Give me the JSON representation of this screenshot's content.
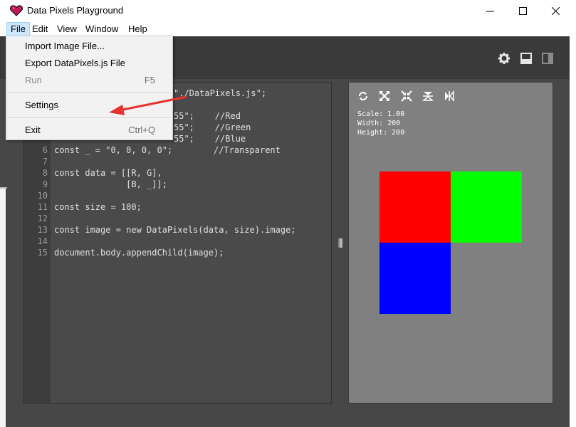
{
  "window": {
    "title": "Data Pixels Playground",
    "min_glyph": "—",
    "max_glyph": "☐",
    "close_glyph": "✕"
  },
  "menubar": {
    "items": [
      "File",
      "Edit",
      "View",
      "Window",
      "Help"
    ]
  },
  "file_menu": {
    "items": [
      {
        "label": "Import Image File...",
        "shortcut": "",
        "enabled": true
      },
      {
        "label": "Export DataPixels.js File",
        "shortcut": "",
        "enabled": true
      },
      {
        "label": "Run",
        "shortcut": "F5",
        "enabled": false
      },
      {
        "label": "Settings",
        "shortcut": "",
        "enabled": true
      },
      {
        "label": "Exit",
        "shortcut": "Ctrl+Q",
        "enabled": true
      }
    ]
  },
  "toolbar": {
    "icons": [
      "gear-icon",
      "layout-horizontal-icon",
      "layout-vertical-icon"
    ]
  },
  "editor": {
    "lines": [
      {
        "n": "",
        "text": "\"./DataPixels.js\";",
        "x": 0
      },
      {
        "n": "",
        "text": "",
        "x": 0
      },
      {
        "n": "",
        "text": "55\";    //Red",
        "x": 0
      },
      {
        "n": "",
        "text": "55\";    //Green",
        "x": 0
      },
      {
        "n": "",
        "text": "55\";    //Blue",
        "x": 0
      },
      {
        "n": "6",
        "text": "const _ = \"0, 0, 0, 0\";        //Transparent",
        "x": 0
      },
      {
        "n": "7",
        "text": "",
        "x": 0
      },
      {
        "n": "8",
        "text": "const data = [[R, G],",
        "x": 0
      },
      {
        "n": "9",
        "text": "              [B, _]];",
        "x": 0
      },
      {
        "n": "10",
        "text": "",
        "x": 0
      },
      {
        "n": "11",
        "text": "const size = 100;",
        "x": 0
      },
      {
        "n": "12",
        "text": "",
        "x": 0
      },
      {
        "n": "13",
        "text": "const image = new DataPixels(data, size).image;",
        "x": 0
      },
      {
        "n": "14",
        "text": "",
        "x": 0
      },
      {
        "n": "15",
        "text": "document.body.appendChild(image);",
        "x": 0
      }
    ]
  },
  "preview": {
    "icons": [
      "refresh-icon",
      "expand-icon",
      "compress-icon",
      "flip-vertical-icon",
      "flip-horizontal-icon"
    ],
    "info": {
      "scale": "Scale: 1.00",
      "width": "Width: 200",
      "height": "Height: 200"
    },
    "pixels": [
      {
        "color": "#ff0000",
        "row": 0,
        "col": 0
      },
      {
        "color": "#00ff00",
        "row": 0,
        "col": 1
      },
      {
        "color": "#0000ff",
        "row": 1,
        "col": 0
      }
    ]
  },
  "colors": {
    "annotation_arrow": "#e8322f",
    "menu_highlight": "#cce8ff"
  }
}
